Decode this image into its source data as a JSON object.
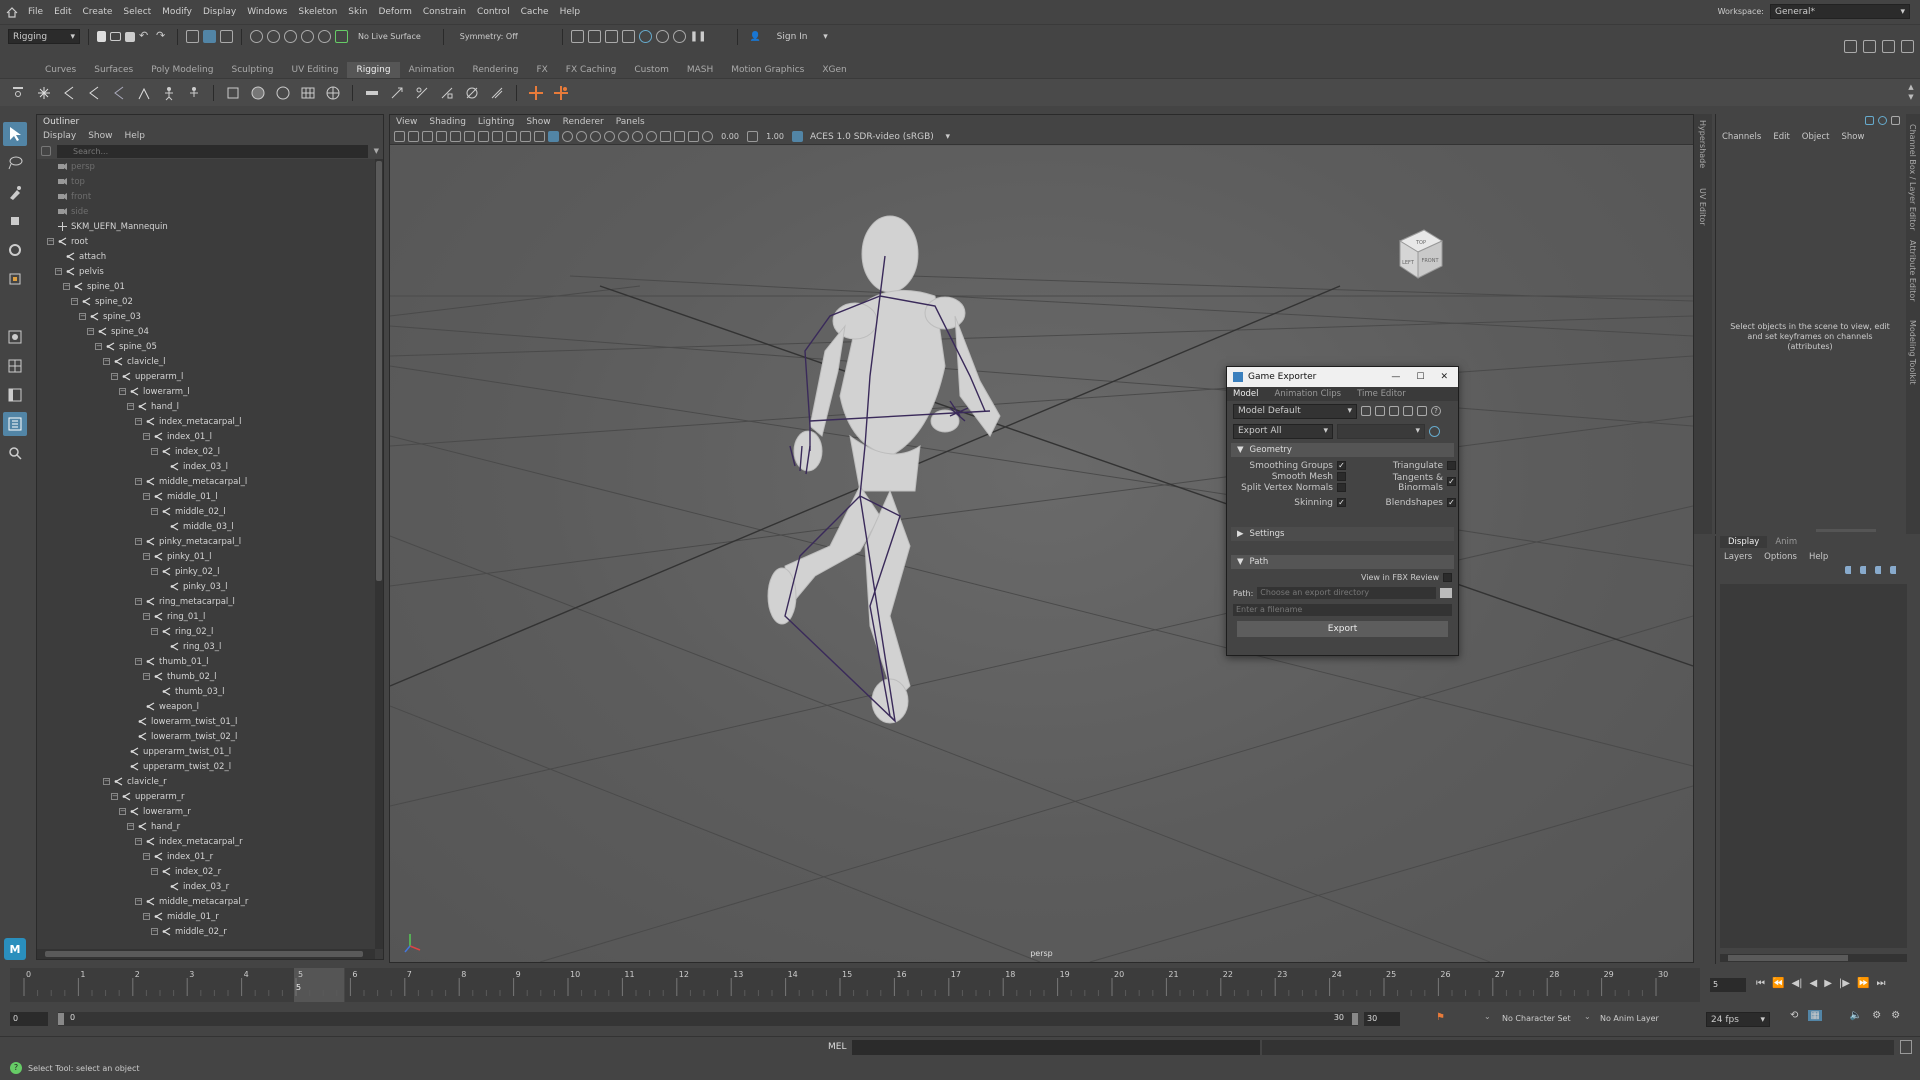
{
  "menubar": {
    "items": [
      "File",
      "Edit",
      "Create",
      "Select",
      "Modify",
      "Display",
      "Windows",
      "Skeleton",
      "Skin",
      "Deform",
      "Constrain",
      "Control",
      "Cache",
      "Help"
    ],
    "workspace_label": "Workspace:",
    "workspace_value": "General*"
  },
  "statusline": {
    "mode": "Rigging",
    "live_surface": "No Live Surface",
    "symmetry": "Symmetry: Off",
    "signin": "Sign In"
  },
  "shelf_tabs": [
    "Curves",
    "Surfaces",
    "Poly Modeling",
    "Sculpting",
    "UV Editing",
    "Rigging",
    "Animation",
    "Rendering",
    "FX",
    "FX Caching",
    "Custom",
    "MASH",
    "Motion Graphics",
    "XGen"
  ],
  "active_shelf": "Rigging",
  "outliner": {
    "title": "Outliner",
    "menus": [
      "Display",
      "Show",
      "Help"
    ],
    "search_placeholder": "Search...",
    "nodes": [
      {
        "t": "persp",
        "d": 0,
        "k": "cam",
        "dim": true
      },
      {
        "t": "top",
        "d": 0,
        "k": "cam",
        "dim": true
      },
      {
        "t": "front",
        "d": 0,
        "k": "cam",
        "dim": true
      },
      {
        "t": "side",
        "d": 0,
        "k": "cam",
        "dim": true
      },
      {
        "t": "SKM_UEFN_Mannequin",
        "d": 0,
        "k": "grp"
      },
      {
        "t": "root",
        "d": 0,
        "k": "jnt",
        "tog": "-"
      },
      {
        "t": "attach",
        "d": 1,
        "k": "jnt"
      },
      {
        "t": "pelvis",
        "d": 1,
        "k": "jnt",
        "tog": "-"
      },
      {
        "t": "spine_01",
        "d": 2,
        "k": "jnt",
        "tog": "-"
      },
      {
        "t": "spine_02",
        "d": 3,
        "k": "jnt",
        "tog": "-"
      },
      {
        "t": "spine_03",
        "d": 4,
        "k": "jnt",
        "tog": "-"
      },
      {
        "t": "spine_04",
        "d": 5,
        "k": "jnt",
        "tog": "-"
      },
      {
        "t": "spine_05",
        "d": 6,
        "k": "jnt",
        "tog": "-"
      },
      {
        "t": "clavicle_l",
        "d": 7,
        "k": "jnt",
        "tog": "-"
      },
      {
        "t": "upperarm_l",
        "d": 8,
        "k": "jnt",
        "tog": "-"
      },
      {
        "t": "lowerarm_l",
        "d": 9,
        "k": "jnt",
        "tog": "-"
      },
      {
        "t": "hand_l",
        "d": 10,
        "k": "jnt",
        "tog": "-"
      },
      {
        "t": "index_metacarpal_l",
        "d": 11,
        "k": "jnt",
        "tog": "-"
      },
      {
        "t": "index_01_l",
        "d": 12,
        "k": "jnt",
        "tog": "-"
      },
      {
        "t": "index_02_l",
        "d": 13,
        "k": "jnt",
        "tog": "-"
      },
      {
        "t": "index_03_l",
        "d": 14,
        "k": "jnt"
      },
      {
        "t": "middle_metacarpal_l",
        "d": 11,
        "k": "jnt",
        "tog": "-"
      },
      {
        "t": "middle_01_l",
        "d": 12,
        "k": "jnt",
        "tog": "-"
      },
      {
        "t": "middle_02_l",
        "d": 13,
        "k": "jnt",
        "tog": "-"
      },
      {
        "t": "middle_03_l",
        "d": 14,
        "k": "jnt"
      },
      {
        "t": "pinky_metacarpal_l",
        "d": 11,
        "k": "jnt",
        "tog": "-"
      },
      {
        "t": "pinky_01_l",
        "d": 12,
        "k": "jnt",
        "tog": "-"
      },
      {
        "t": "pinky_02_l",
        "d": 13,
        "k": "jnt",
        "tog": "-"
      },
      {
        "t": "pinky_03_l",
        "d": 14,
        "k": "jnt"
      },
      {
        "t": "ring_metacarpal_l",
        "d": 11,
        "k": "jnt",
        "tog": "-"
      },
      {
        "t": "ring_01_l",
        "d": 12,
        "k": "jnt",
        "tog": "-"
      },
      {
        "t": "ring_02_l",
        "d": 13,
        "k": "jnt",
        "tog": "-"
      },
      {
        "t": "ring_03_l",
        "d": 14,
        "k": "jnt"
      },
      {
        "t": "thumb_01_l",
        "d": 11,
        "k": "jnt",
        "tog": "-"
      },
      {
        "t": "thumb_02_l",
        "d": 12,
        "k": "jnt",
        "tog": "-"
      },
      {
        "t": "thumb_03_l",
        "d": 13,
        "k": "jnt"
      },
      {
        "t": "weapon_l",
        "d": 11,
        "k": "jnt"
      },
      {
        "t": "lowerarm_twist_01_l",
        "d": 10,
        "k": "jnt"
      },
      {
        "t": "lowerarm_twist_02_l",
        "d": 10,
        "k": "jnt"
      },
      {
        "t": "upperarm_twist_01_l",
        "d": 9,
        "k": "jnt"
      },
      {
        "t": "upperarm_twist_02_l",
        "d": 9,
        "k": "jnt"
      },
      {
        "t": "clavicle_r",
        "d": 7,
        "k": "jnt",
        "tog": "-"
      },
      {
        "t": "upperarm_r",
        "d": 8,
        "k": "jnt",
        "tog": "-"
      },
      {
        "t": "lowerarm_r",
        "d": 9,
        "k": "jnt",
        "tog": "-"
      },
      {
        "t": "hand_r",
        "d": 10,
        "k": "jnt",
        "tog": "-"
      },
      {
        "t": "index_metacarpal_r",
        "d": 11,
        "k": "jnt",
        "tog": "-"
      },
      {
        "t": "index_01_r",
        "d": 12,
        "k": "jnt",
        "tog": "-"
      },
      {
        "t": "index_02_r",
        "d": 13,
        "k": "jnt",
        "tog": "-"
      },
      {
        "t": "index_03_r",
        "d": 14,
        "k": "jnt"
      },
      {
        "t": "middle_metacarpal_r",
        "d": 11,
        "k": "jnt",
        "tog": "-"
      },
      {
        "t": "middle_01_r",
        "d": 12,
        "k": "jnt",
        "tog": "-"
      },
      {
        "t": "middle_02_r",
        "d": 13,
        "k": "jnt",
        "tog": "-"
      }
    ]
  },
  "viewport": {
    "menus": [
      "View",
      "Shading",
      "Lighting",
      "Show",
      "Renderer",
      "Panels"
    ],
    "exposure": "0.00",
    "gamma": "1.00",
    "colorspace": "ACES 1.0 SDR-video (sRGB)",
    "camera_label": "persp",
    "viewcube_top": "TOP",
    "viewcube_left": "LEFT",
    "viewcube_front": "FRONT"
  },
  "exporter": {
    "title": "Game Exporter",
    "tabs": [
      "Model",
      "Animation Clips",
      "Time Editor"
    ],
    "preset": "Model Default",
    "export_mode": "Export All",
    "geometry_label": "Geometry",
    "smoothing_groups": "Smoothing Groups",
    "smooth_mesh": "Smooth Mesh",
    "split_vertex_normals": "Split Vertex Normals",
    "skinning": "Skinning",
    "triangulate": "Triangulate",
    "tangents_binormals": "Tangents & Binormals",
    "blendshapes": "Blendshapes",
    "settings_label": "Settings",
    "path_section": "Path",
    "view_fbx": "View in FBX Review",
    "path_label": "Path:",
    "path_placeholder": "Choose an export directory",
    "filename_placeholder": "Enter a filename",
    "export_button": "Export"
  },
  "channelbox": {
    "menus": [
      "Channels",
      "Edit",
      "Object",
      "Show"
    ],
    "message": "Select objects in the scene to view, edit and set keyframes on channels (attributes)",
    "side_tabs": [
      "Channel Box / Layer Editor",
      "Attribute Editor",
      "Modeling Toolkit"
    ],
    "left_tabs": [
      "Hypershade",
      "UV Editor"
    ]
  },
  "layereditor": {
    "tabs": [
      "Display",
      "Anim"
    ],
    "menus": [
      "Layers",
      "Options",
      "Help"
    ]
  },
  "timeline": {
    "ticks": [
      "0",
      "1",
      "2",
      "3",
      "4",
      "5",
      "6",
      "7",
      "8",
      "9",
      "10",
      "11",
      "12",
      "13",
      "14",
      "15",
      "16",
      "17",
      "18",
      "19",
      "20",
      "21",
      "22",
      "23",
      "24",
      "25",
      "26",
      "27",
      "28",
      "29",
      "30"
    ],
    "current_frame": "5",
    "current_frame_field": "5"
  },
  "range": {
    "start_outer": "0",
    "start_inner": "0",
    "end_inner": "30",
    "end_outer": "30",
    "character_set": "No Character Set",
    "anim_layer": "No Anim Layer",
    "fps": "24 fps"
  },
  "cmdline": {
    "label": "MEL"
  },
  "helpline": {
    "text": "Select Tool: select an object"
  },
  "colors": {
    "accent": "#5285a6",
    "bone": "#3a2a5a",
    "timeline_cursor": "#8aa8c8"
  }
}
